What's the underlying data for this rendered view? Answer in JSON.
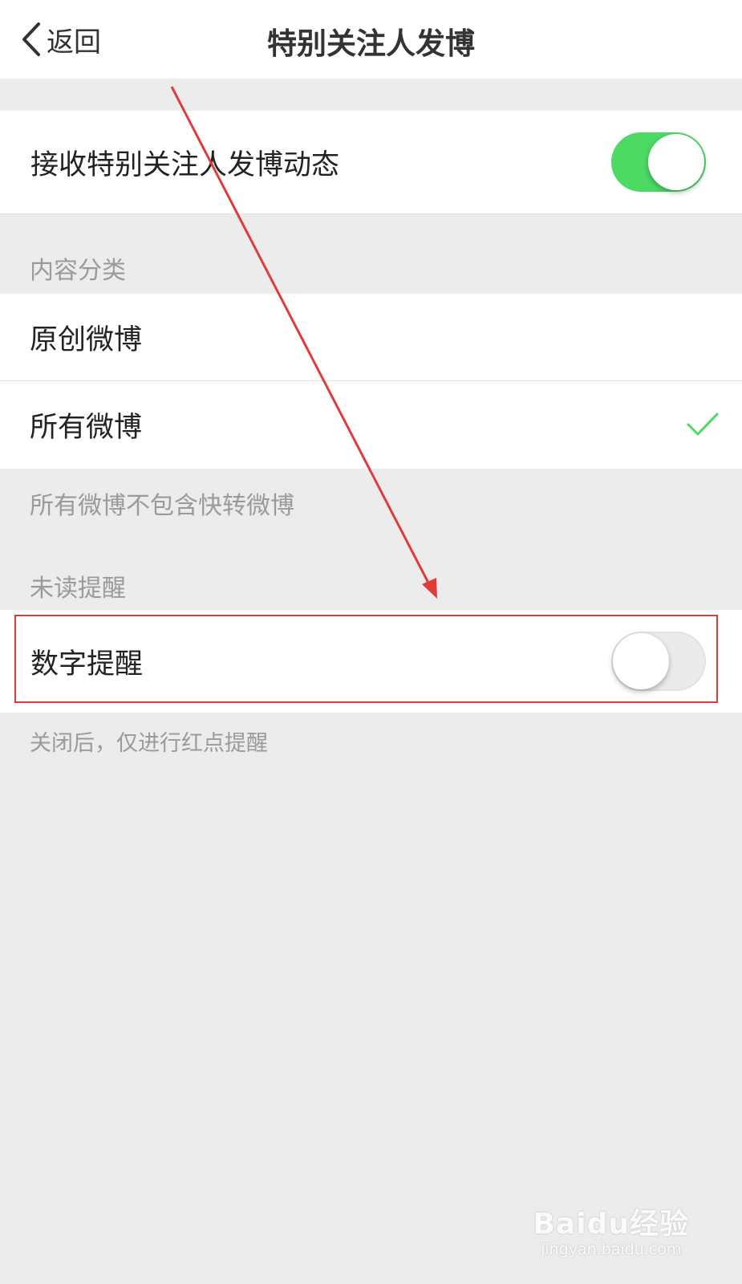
{
  "nav": {
    "back_label": "返回",
    "title": "特别关注人发博"
  },
  "receive": {
    "label": "接收特别关注人发博动态",
    "enabled": true
  },
  "content_category": {
    "header": "内容分类",
    "options": [
      {
        "label": "原创微博",
        "selected": false
      },
      {
        "label": "所有微博",
        "selected": true
      }
    ],
    "footer": "所有微博不包含快转微博"
  },
  "unread_reminder": {
    "header": "未读提醒",
    "number_label": "数字提醒",
    "number_enabled": false,
    "footer": "关闭后，仅进行红点提醒"
  },
  "colors": {
    "toggle_on": "#4cd964",
    "check": "#4cd964",
    "annotation_red": "#e03b3b"
  },
  "watermark": {
    "logo": "Baidu经验",
    "url": "jingyan.baidu.com"
  }
}
